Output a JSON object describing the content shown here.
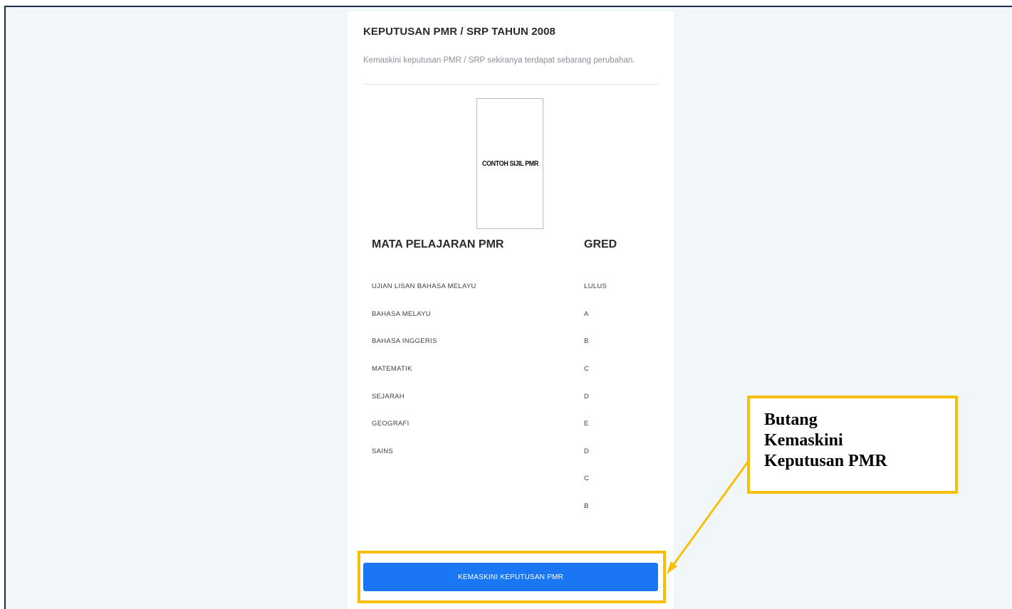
{
  "card": {
    "title": "KEPUTUSAN PMR / SRP TAHUN 2008",
    "subtitle": "Kemaskini keputusan PMR / SRP sekiranya terdapat sebarang perubahan.",
    "certificate_label": "CONTOH SIJIL PMR"
  },
  "results": {
    "headers": {
      "subject": "MATA PELAJARAN PMR",
      "grade": "GRED"
    },
    "subjects": [
      "UJIAN LISAN BAHASA MELAYU",
      "BAHASA MELAYU",
      "BAHASA INGGERIS",
      "MATEMATIK",
      "SEJARAH",
      "GEOGRAFI",
      "SAINS"
    ],
    "grades": [
      "LULUS",
      "A",
      "B",
      "C",
      "D",
      "E",
      "D",
      "C",
      "B"
    ]
  },
  "actions": {
    "update_label": "KEMASKINI KEPUTUSAN PMR"
  },
  "callout": {
    "line1": "Butang",
    "line2": "Kemaskini",
    "line3": "Keputusan PMR"
  },
  "colors": {
    "primary_button": "#1a76f2",
    "highlight": "#f8bf0a",
    "page_bg": "#f1f6f9"
  }
}
